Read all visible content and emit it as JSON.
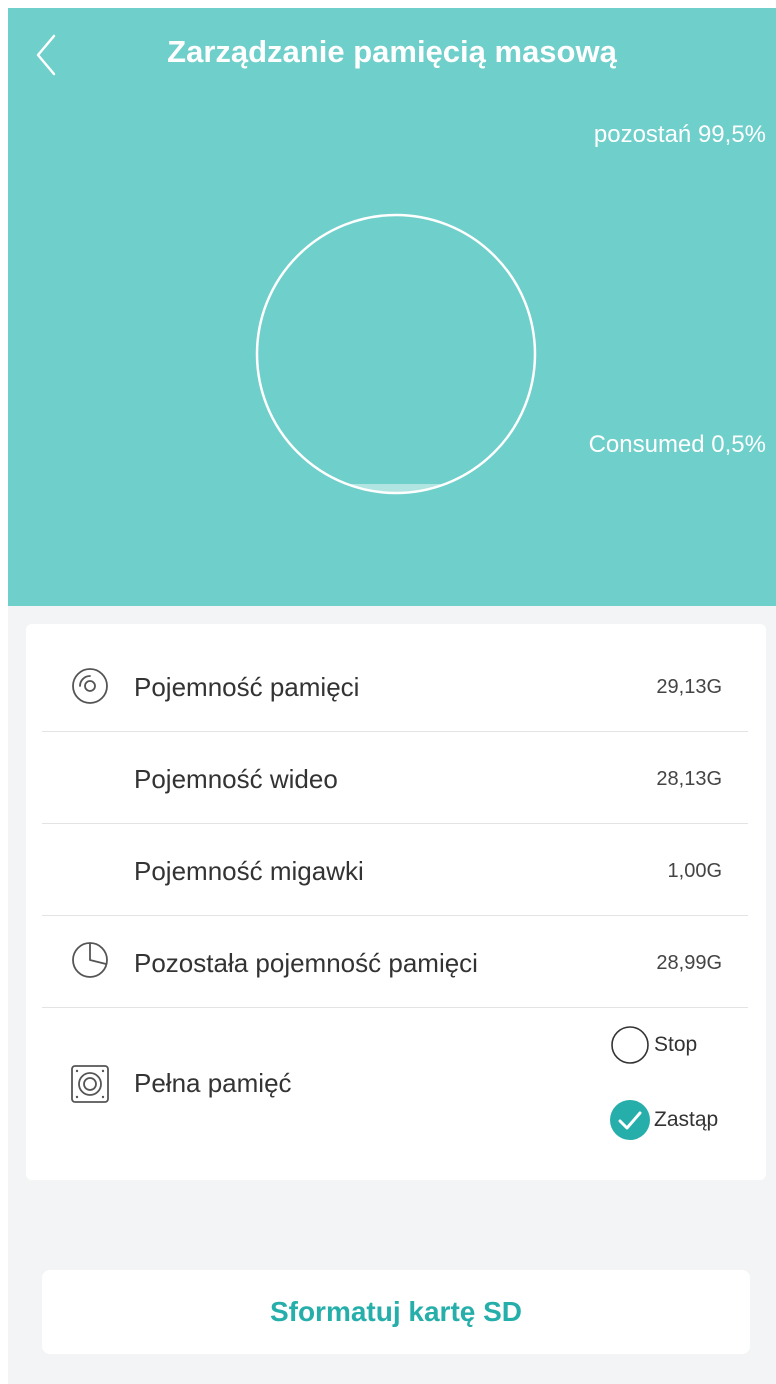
{
  "header": {
    "title": "Zarządzanie pamięcią masową",
    "remaining_label": "pozostań 99,5%",
    "consumed_label": "Consumed 0,5%",
    "colors": {
      "background": "#6fcfcb",
      "text": "#ffffff"
    }
  },
  "gauge": {
    "remaining_percent": 99.5,
    "consumed_percent": 0.5
  },
  "storage_rows": [
    {
      "label": "Pojemność pamięci",
      "value": "29,13G",
      "icon": "disc-icon"
    },
    {
      "label": "Pojemność wideo",
      "value": "28,13G",
      "icon": ""
    },
    {
      "label": "Pojemność migawki",
      "value": "1,00G",
      "icon": ""
    },
    {
      "label": "Pozostała pojemność pamięci",
      "value": "28,99G",
      "icon": "pie-chart-icon"
    }
  ],
  "full_storage": {
    "label": "Pełna pamięć",
    "icon": "speaker-icon",
    "options": [
      {
        "label": "Stop",
        "selected": false
      },
      {
        "label": "Zastąp",
        "selected": true
      }
    ]
  },
  "format_button": {
    "label": "Sformatuj kartę SD",
    "color": "#25aeaa"
  }
}
